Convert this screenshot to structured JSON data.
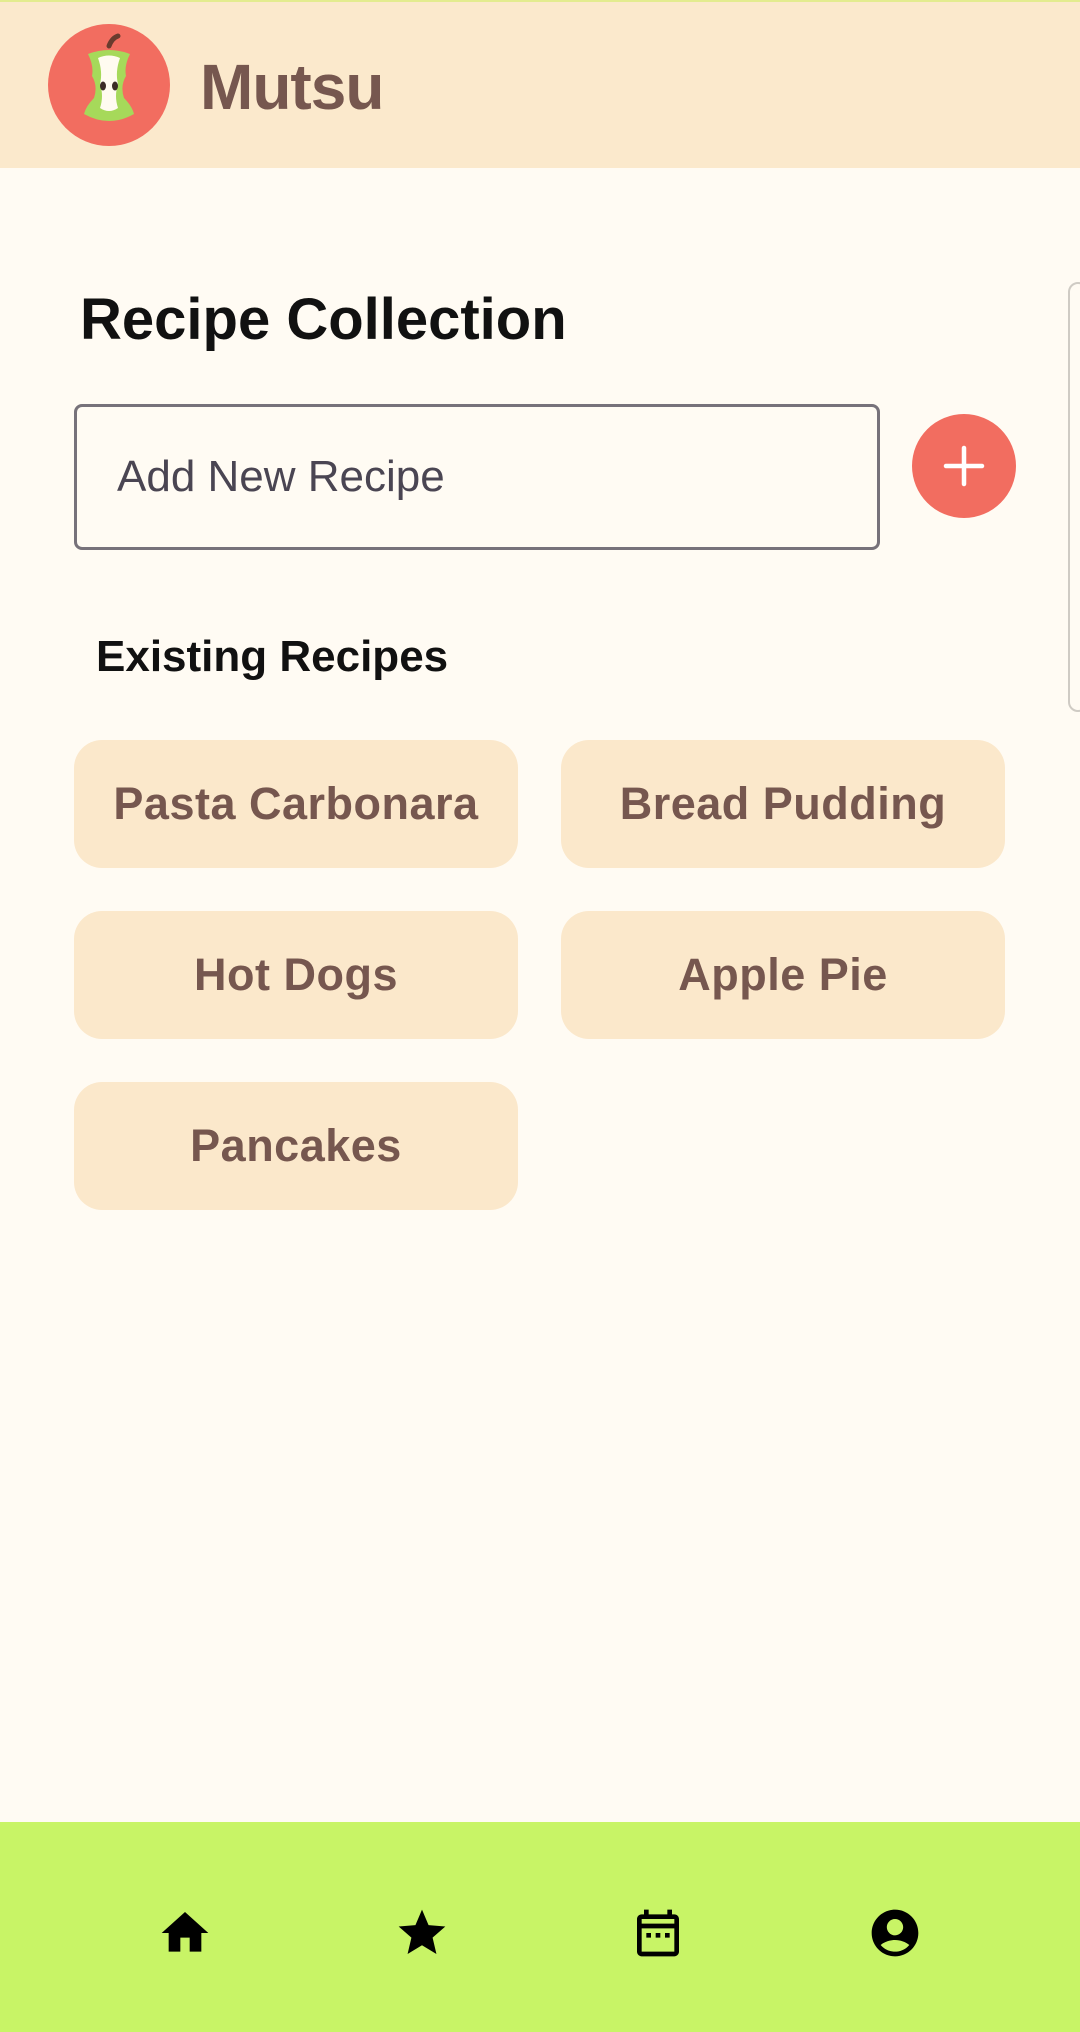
{
  "header": {
    "app_name": "Mutsu",
    "logo_icon": "apple-core-icon",
    "logo_background": "#F26D60"
  },
  "main": {
    "title": "Recipe Collection",
    "input_placeholder": "Add New Recipe",
    "add_button_icon": "plus-icon",
    "section_title": "Existing Recipes",
    "recipes": [
      {
        "label": "Pasta Carbonara"
      },
      {
        "label": "Bread Pudding"
      },
      {
        "label": "Hot Dogs"
      },
      {
        "label": "Apple Pie"
      },
      {
        "label": "Pancakes"
      }
    ]
  },
  "bottom_nav": {
    "items": [
      {
        "icon": "home-icon"
      },
      {
        "icon": "star-icon"
      },
      {
        "icon": "calendar-icon"
      },
      {
        "icon": "account-icon"
      }
    ]
  },
  "colors": {
    "header_bg": "#FBE9CC",
    "page_bg": "#FFFBF3",
    "chip_bg": "#FBE8CB",
    "chip_text": "#76574F",
    "accent": "#F26D60",
    "nav_bg": "#C8F466"
  }
}
